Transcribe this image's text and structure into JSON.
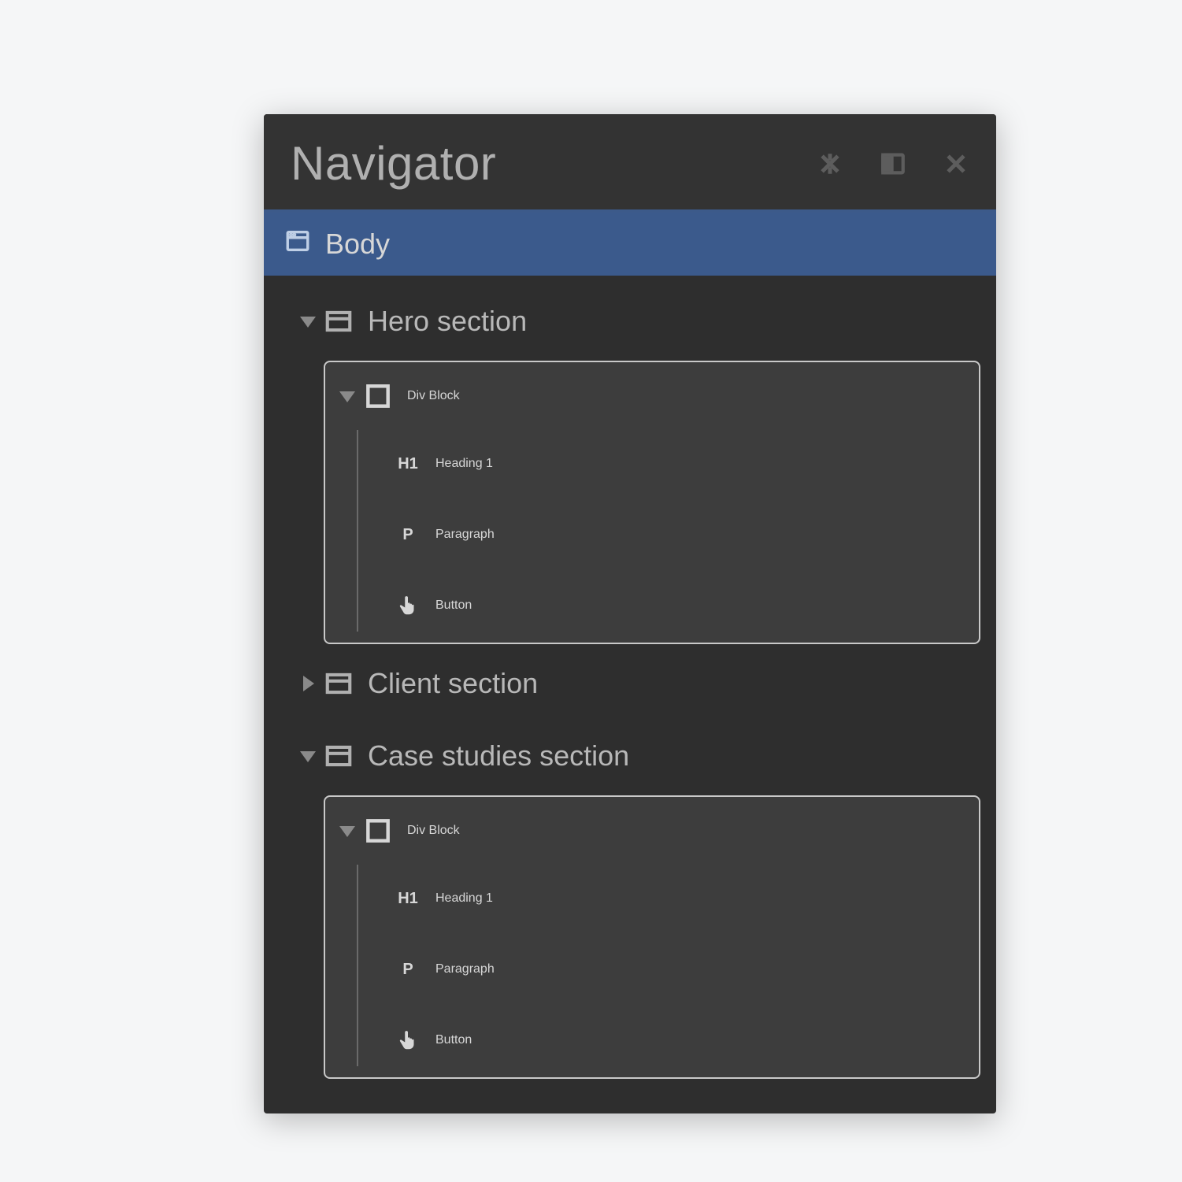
{
  "panel": {
    "title": "Navigator",
    "body_label": "Body"
  },
  "tree": {
    "sections": [
      {
        "name": "Hero section",
        "expanded": true,
        "div": {
          "label": "Div Block",
          "children": [
            {
              "kind": "h1",
              "label": "Heading 1"
            },
            {
              "kind": "para",
              "label": "Paragraph"
            },
            {
              "kind": "btn",
              "label": "Button"
            }
          ]
        }
      },
      {
        "name": "Client section",
        "expanded": false
      },
      {
        "name": "Case studies section",
        "expanded": true,
        "div": {
          "label": "Div Block",
          "children": [
            {
              "kind": "h1",
              "label": "Heading 1"
            },
            {
              "kind": "para",
              "label": "Paragraph"
            },
            {
              "kind": "btn",
              "label": "Button"
            }
          ]
        }
      }
    ]
  }
}
